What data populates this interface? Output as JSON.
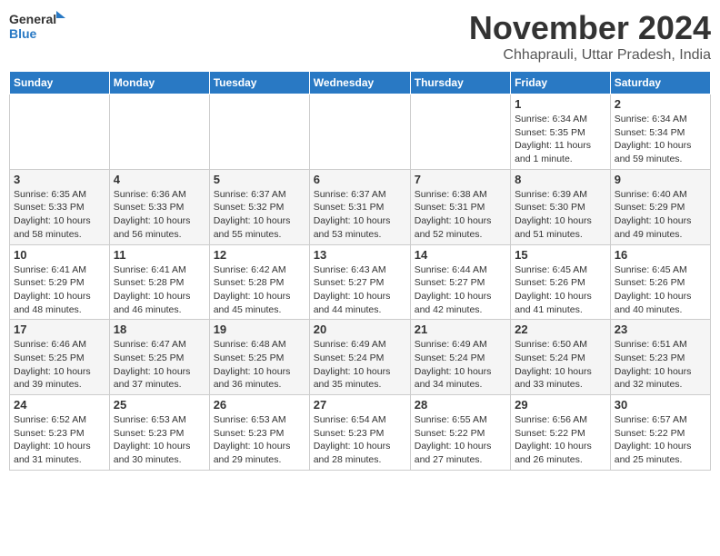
{
  "logo": {
    "line1": "General",
    "line2": "Blue"
  },
  "title": "November 2024",
  "subtitle": "Chhaprauli, Uttar Pradesh, India",
  "weekdays": [
    "Sunday",
    "Monday",
    "Tuesday",
    "Wednesday",
    "Thursday",
    "Friday",
    "Saturday"
  ],
  "weeks": [
    [
      {
        "day": "",
        "info": ""
      },
      {
        "day": "",
        "info": ""
      },
      {
        "day": "",
        "info": ""
      },
      {
        "day": "",
        "info": ""
      },
      {
        "day": "",
        "info": ""
      },
      {
        "day": "1",
        "info": "Sunrise: 6:34 AM\nSunset: 5:35 PM\nDaylight: 11 hours and 1 minute."
      },
      {
        "day": "2",
        "info": "Sunrise: 6:34 AM\nSunset: 5:34 PM\nDaylight: 10 hours and 59 minutes."
      }
    ],
    [
      {
        "day": "3",
        "info": "Sunrise: 6:35 AM\nSunset: 5:33 PM\nDaylight: 10 hours and 58 minutes."
      },
      {
        "day": "4",
        "info": "Sunrise: 6:36 AM\nSunset: 5:33 PM\nDaylight: 10 hours and 56 minutes."
      },
      {
        "day": "5",
        "info": "Sunrise: 6:37 AM\nSunset: 5:32 PM\nDaylight: 10 hours and 55 minutes."
      },
      {
        "day": "6",
        "info": "Sunrise: 6:37 AM\nSunset: 5:31 PM\nDaylight: 10 hours and 53 minutes."
      },
      {
        "day": "7",
        "info": "Sunrise: 6:38 AM\nSunset: 5:31 PM\nDaylight: 10 hours and 52 minutes."
      },
      {
        "day": "8",
        "info": "Sunrise: 6:39 AM\nSunset: 5:30 PM\nDaylight: 10 hours and 51 minutes."
      },
      {
        "day": "9",
        "info": "Sunrise: 6:40 AM\nSunset: 5:29 PM\nDaylight: 10 hours and 49 minutes."
      }
    ],
    [
      {
        "day": "10",
        "info": "Sunrise: 6:41 AM\nSunset: 5:29 PM\nDaylight: 10 hours and 48 minutes."
      },
      {
        "day": "11",
        "info": "Sunrise: 6:41 AM\nSunset: 5:28 PM\nDaylight: 10 hours and 46 minutes."
      },
      {
        "day": "12",
        "info": "Sunrise: 6:42 AM\nSunset: 5:28 PM\nDaylight: 10 hours and 45 minutes."
      },
      {
        "day": "13",
        "info": "Sunrise: 6:43 AM\nSunset: 5:27 PM\nDaylight: 10 hours and 44 minutes."
      },
      {
        "day": "14",
        "info": "Sunrise: 6:44 AM\nSunset: 5:27 PM\nDaylight: 10 hours and 42 minutes."
      },
      {
        "day": "15",
        "info": "Sunrise: 6:45 AM\nSunset: 5:26 PM\nDaylight: 10 hours and 41 minutes."
      },
      {
        "day": "16",
        "info": "Sunrise: 6:45 AM\nSunset: 5:26 PM\nDaylight: 10 hours and 40 minutes."
      }
    ],
    [
      {
        "day": "17",
        "info": "Sunrise: 6:46 AM\nSunset: 5:25 PM\nDaylight: 10 hours and 39 minutes."
      },
      {
        "day": "18",
        "info": "Sunrise: 6:47 AM\nSunset: 5:25 PM\nDaylight: 10 hours and 37 minutes."
      },
      {
        "day": "19",
        "info": "Sunrise: 6:48 AM\nSunset: 5:25 PM\nDaylight: 10 hours and 36 minutes."
      },
      {
        "day": "20",
        "info": "Sunrise: 6:49 AM\nSunset: 5:24 PM\nDaylight: 10 hours and 35 minutes."
      },
      {
        "day": "21",
        "info": "Sunrise: 6:49 AM\nSunset: 5:24 PM\nDaylight: 10 hours and 34 minutes."
      },
      {
        "day": "22",
        "info": "Sunrise: 6:50 AM\nSunset: 5:24 PM\nDaylight: 10 hours and 33 minutes."
      },
      {
        "day": "23",
        "info": "Sunrise: 6:51 AM\nSunset: 5:23 PM\nDaylight: 10 hours and 32 minutes."
      }
    ],
    [
      {
        "day": "24",
        "info": "Sunrise: 6:52 AM\nSunset: 5:23 PM\nDaylight: 10 hours and 31 minutes."
      },
      {
        "day": "25",
        "info": "Sunrise: 6:53 AM\nSunset: 5:23 PM\nDaylight: 10 hours and 30 minutes."
      },
      {
        "day": "26",
        "info": "Sunrise: 6:53 AM\nSunset: 5:23 PM\nDaylight: 10 hours and 29 minutes."
      },
      {
        "day": "27",
        "info": "Sunrise: 6:54 AM\nSunset: 5:23 PM\nDaylight: 10 hours and 28 minutes."
      },
      {
        "day": "28",
        "info": "Sunrise: 6:55 AM\nSunset: 5:22 PM\nDaylight: 10 hours and 27 minutes."
      },
      {
        "day": "29",
        "info": "Sunrise: 6:56 AM\nSunset: 5:22 PM\nDaylight: 10 hours and 26 minutes."
      },
      {
        "day": "30",
        "info": "Sunrise: 6:57 AM\nSunset: 5:22 PM\nDaylight: 10 hours and 25 minutes."
      }
    ]
  ]
}
